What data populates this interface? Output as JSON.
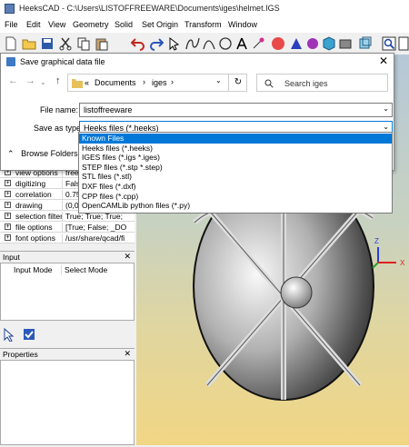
{
  "window": {
    "title": "HeeksCAD - C:\\Users\\LISTOFFREEWARE\\Documents\\iges\\helmet.IGS"
  },
  "menu": [
    "File",
    "Edit",
    "View",
    "Geometry",
    "Solid",
    "Set Origin",
    "Transform",
    "Window"
  ],
  "toolbar_icons": [
    "new-file-icon",
    "open-folder-icon",
    "save-icon",
    "cut-icon",
    "copy-icon",
    "paste-icon",
    "undo-icon",
    "redo-icon",
    "select-icon",
    "line-icon",
    "circle-icon",
    "text-icon",
    "coordinate-icon",
    "sphere-icon",
    "cone-icon",
    "cylinder-icon",
    "cube-icon",
    "zoom-icon"
  ],
  "properties": [
    {
      "name": "view options",
      "value": "free"
    },
    {
      "name": "digitizing",
      "value": "False"
    },
    {
      "name": "correlation",
      "value": "0.75"
    },
    {
      "name": "drawing",
      "value": "(0,0"
    },
    {
      "name": "selection filter",
      "value": "True; True; True;"
    },
    {
      "name": "file options",
      "value": "[True; False; _DO"
    },
    {
      "name": "font options",
      "value": "/usr/share/qcad/fi"
    }
  ],
  "input_panel": {
    "title": "Input",
    "col1": "Input Mode",
    "col2": "Select Mode"
  },
  "properties_panel": {
    "title": "Properties"
  },
  "dialog": {
    "title": "Save graphical data file",
    "path": [
      "«",
      "Documents",
      "›",
      "iges",
      "›"
    ],
    "search_placeholder": "Search iges",
    "filename_label": "File name:",
    "filename_value": "listoffreeware",
    "savetype_label": "Save as type:",
    "savetype_value": "Heeks files (*.heeks)",
    "browse_label": "Browse Folders",
    "types": [
      "Known Files",
      "Heeks files (*.heeks)",
      "IGES files (*.igs *.iges)",
      "STEP files (*.stp *.step)",
      "STL files (*.stl)",
      "DXF files (*.dxf)",
      "CPP files (*.cpp)",
      "OpenCAMLib python files (*.py)"
    ],
    "selected_type_index": 0
  },
  "axes": {
    "z": "Z",
    "x": "X"
  },
  "colors": {
    "accent": "#0078d7",
    "axis_z": "#2a3fd6",
    "axis_x": "#e02020",
    "axis_y": "#30a030"
  }
}
